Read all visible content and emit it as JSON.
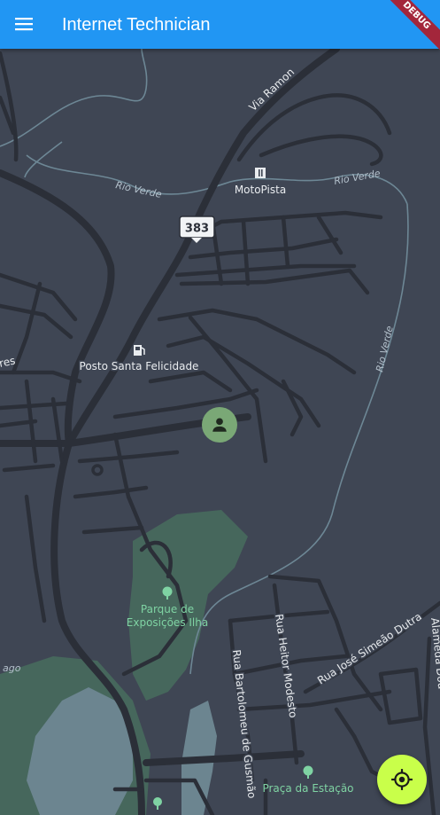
{
  "app": {
    "title": "Internet Technician",
    "debug_banner": "DEBUG"
  },
  "map": {
    "road_shield": "383",
    "roads": {
      "via_ramon": "Via Ramon",
      "rio_verde_1": "Rio Verde",
      "rio_verde_2": "Rio Verde",
      "rio_verde_3": "Rio Verde",
      "rua_jose_simeao_dutra": "Rua José Simeão Dutra",
      "rua_heitor_modesto": "Rua Heitor Modesto",
      "rua_bartolomeu_de_gusmao": "Rua Bartolomeu de Gusmão",
      "alameda_partial": "Alameda Dou",
      "edge_partial_left": "res",
      "lago_partial": "ago"
    },
    "pois": {
      "motopista": "MotoPista",
      "posto": "Posto Santa Felicidade",
      "parque_line1": "Parque de",
      "parque_line2": "Exposições Ilha",
      "praca": "Praça da Estação"
    },
    "colors": {
      "background": "#3f4654",
      "road": "#2b2f38",
      "park": "#46675c",
      "water": "#6c8590",
      "accent_fab": "#c9ff4a",
      "user_marker": "#7aa876",
      "appbar": "#2196f3"
    }
  },
  "icons": {
    "menu": "menu-icon",
    "user": "person-icon",
    "locate": "my-location-icon",
    "fuel": "fuel-station-icon",
    "moto": "motorcycle-shop-icon",
    "tree": "tree-icon"
  }
}
